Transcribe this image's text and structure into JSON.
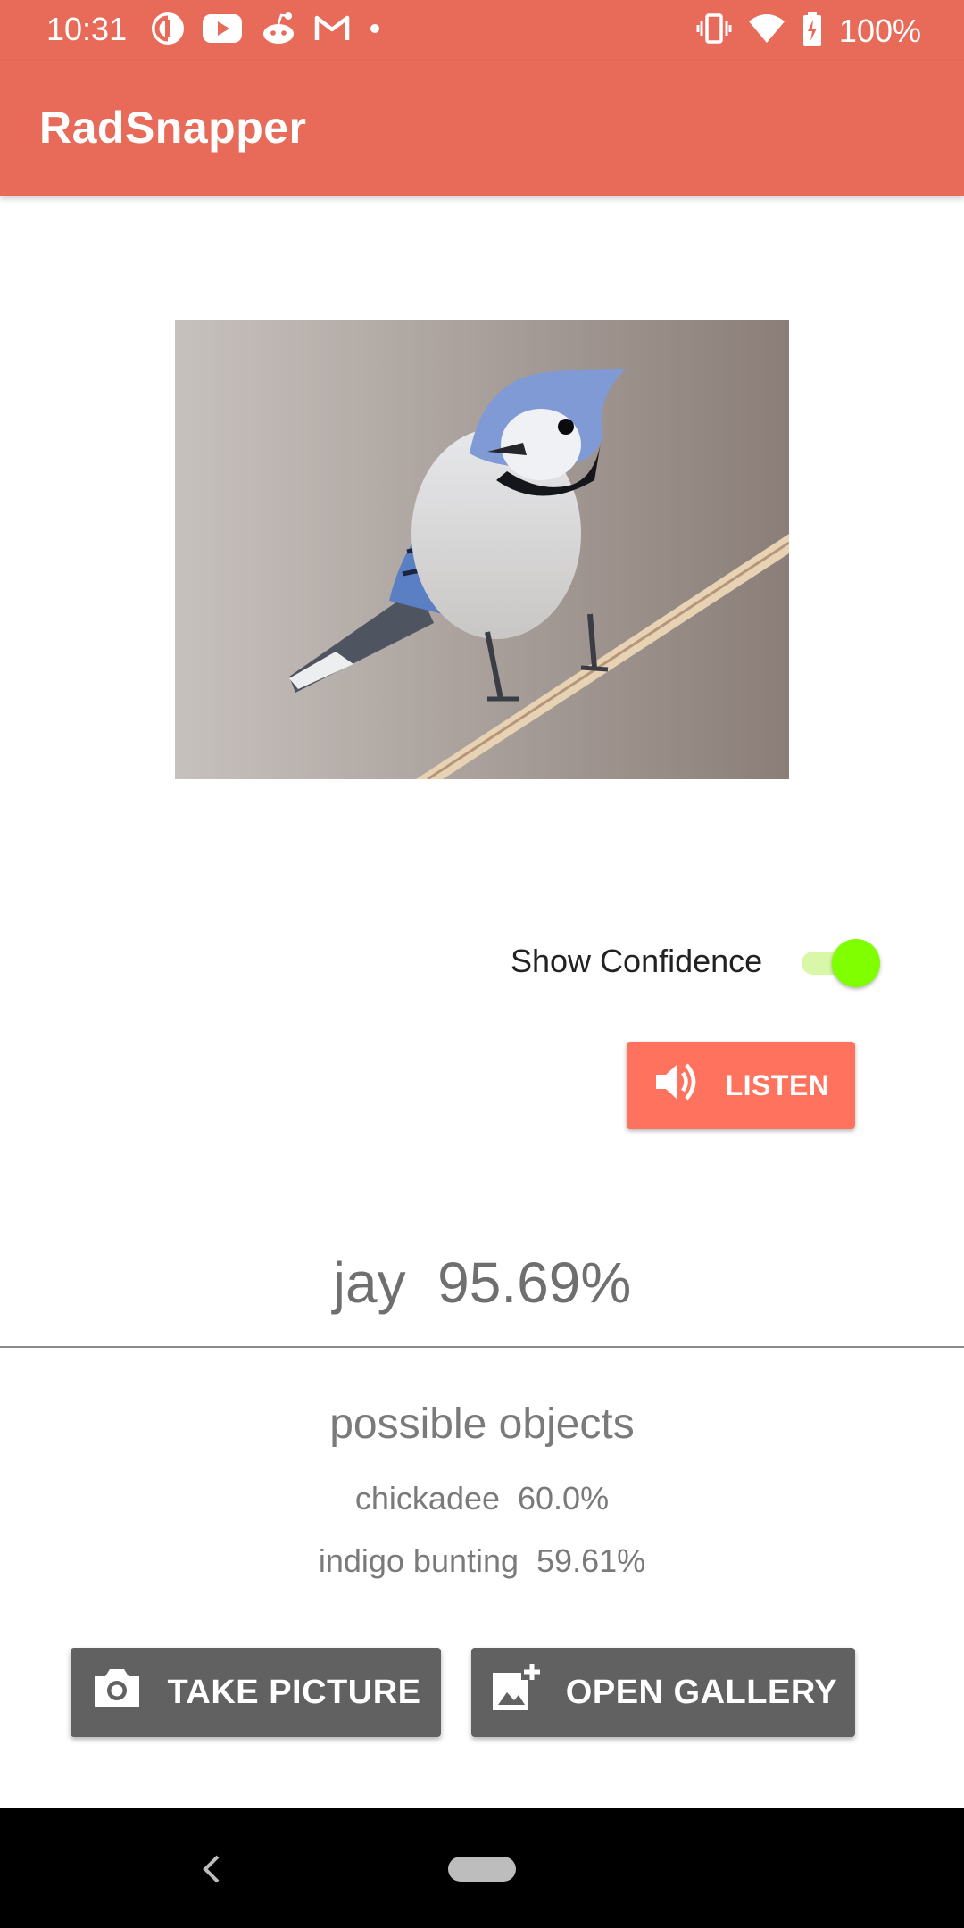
{
  "status_bar": {
    "time": "10:31",
    "left_icons": [
      "pocket-casts-icon",
      "youtube-icon",
      "reddit-icon",
      "gmail-icon",
      "notification-dot-icon"
    ],
    "right_icons": [
      "vibrate-icon",
      "wifi-icon",
      "battery-charging-icon"
    ],
    "battery": "100%"
  },
  "app_bar": {
    "title": "RadSnapper",
    "color": "#E86A58"
  },
  "photo": {
    "subject": "blue jay on branch"
  },
  "confidence_toggle": {
    "label": "Show Confidence",
    "checked": true,
    "thumb_color": "#7FFF00"
  },
  "listen_button": {
    "label": "LISTEN",
    "icon": "volume-icon",
    "color": "#FF735E"
  },
  "prediction": {
    "text": "jay  95.69%"
  },
  "possible_objects": {
    "header": "possible objects",
    "items": [
      {
        "text": "chickadee  60.0%"
      },
      {
        "text": "indigo bunting  59.61%"
      }
    ]
  },
  "actions": {
    "take_picture": {
      "label": "TAKE PICTURE",
      "icon": "camera-icon"
    },
    "open_gallery": {
      "label": "OPEN GALLERY",
      "icon": "add-photo-icon"
    },
    "color": "#616161"
  },
  "nav_bar": {
    "icons": [
      "back-icon",
      "home-pill-icon"
    ]
  }
}
